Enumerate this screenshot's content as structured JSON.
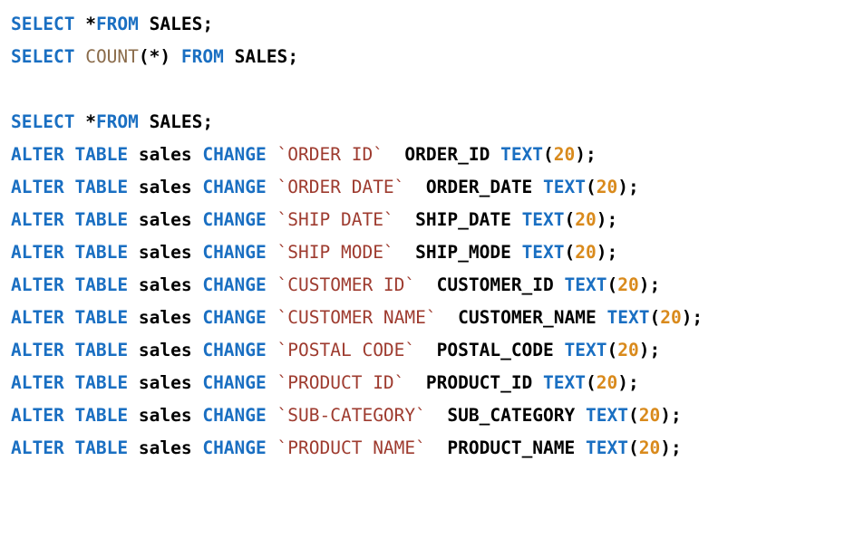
{
  "colors": {
    "keyword": "#1a6fc2",
    "function": "#8a6b4a",
    "string": "#9e3b2f",
    "number": "#d98a1c",
    "text": "#000000",
    "background": "#ffffff"
  },
  "lines": [
    {
      "tokens": [
        {
          "t": "kw",
          "v": "SELECT"
        },
        {
          "t": "ident",
          "v": " *"
        },
        {
          "t": "kw",
          "v": "FROM"
        },
        {
          "t": "ident",
          "v": " SALES"
        },
        {
          "t": "punc",
          "v": ";"
        }
      ]
    },
    {
      "tokens": [
        {
          "t": "kw",
          "v": "SELECT"
        },
        {
          "t": "ident",
          "v": " "
        },
        {
          "t": "fn",
          "v": "COUNT"
        },
        {
          "t": "punc",
          "v": "(*)"
        },
        {
          "t": "ident",
          "v": " "
        },
        {
          "t": "kw",
          "v": "FROM"
        },
        {
          "t": "ident",
          "v": " SALES"
        },
        {
          "t": "punc",
          "v": ";"
        }
      ]
    },
    {
      "tokens": []
    },
    {
      "tokens": [
        {
          "t": "kw",
          "v": "SELECT"
        },
        {
          "t": "ident",
          "v": " *"
        },
        {
          "t": "kw",
          "v": "FROM"
        },
        {
          "t": "ident",
          "v": " SALES"
        },
        {
          "t": "punc",
          "v": ";"
        }
      ]
    },
    {
      "tokens": [
        {
          "t": "kw",
          "v": "ALTER TABLE"
        },
        {
          "t": "ident",
          "v": " sales "
        },
        {
          "t": "kw",
          "v": "CHANGE"
        },
        {
          "t": "ident",
          "v": " "
        },
        {
          "t": "str",
          "v": "`ORDER ID`"
        },
        {
          "t": "ident",
          "v": "  ORDER_ID "
        },
        {
          "t": "kw",
          "v": "TEXT"
        },
        {
          "t": "punc",
          "v": "("
        },
        {
          "t": "num",
          "v": "20"
        },
        {
          "t": "punc",
          "v": ");"
        }
      ]
    },
    {
      "tokens": [
        {
          "t": "kw",
          "v": "ALTER TABLE"
        },
        {
          "t": "ident",
          "v": " sales "
        },
        {
          "t": "kw",
          "v": "CHANGE"
        },
        {
          "t": "ident",
          "v": " "
        },
        {
          "t": "str",
          "v": "`ORDER DATE`"
        },
        {
          "t": "ident",
          "v": "  ORDER_DATE "
        },
        {
          "t": "kw",
          "v": "TEXT"
        },
        {
          "t": "punc",
          "v": "("
        },
        {
          "t": "num",
          "v": "20"
        },
        {
          "t": "punc",
          "v": ");"
        }
      ]
    },
    {
      "tokens": [
        {
          "t": "kw",
          "v": "ALTER TABLE"
        },
        {
          "t": "ident",
          "v": " sales "
        },
        {
          "t": "kw",
          "v": "CHANGE"
        },
        {
          "t": "ident",
          "v": " "
        },
        {
          "t": "str",
          "v": "`SHIP DATE`"
        },
        {
          "t": "ident",
          "v": "  SHIP_DATE "
        },
        {
          "t": "kw",
          "v": "TEXT"
        },
        {
          "t": "punc",
          "v": "("
        },
        {
          "t": "num",
          "v": "20"
        },
        {
          "t": "punc",
          "v": ");"
        }
      ]
    },
    {
      "tokens": [
        {
          "t": "kw",
          "v": "ALTER TABLE"
        },
        {
          "t": "ident",
          "v": " sales "
        },
        {
          "t": "kw",
          "v": "CHANGE"
        },
        {
          "t": "ident",
          "v": " "
        },
        {
          "t": "str",
          "v": "`SHIP MODE`"
        },
        {
          "t": "ident",
          "v": "  SHIP_MODE "
        },
        {
          "t": "kw",
          "v": "TEXT"
        },
        {
          "t": "punc",
          "v": "("
        },
        {
          "t": "num",
          "v": "20"
        },
        {
          "t": "punc",
          "v": ");"
        }
      ]
    },
    {
      "tokens": [
        {
          "t": "kw",
          "v": "ALTER TABLE"
        },
        {
          "t": "ident",
          "v": " sales "
        },
        {
          "t": "kw",
          "v": "CHANGE"
        },
        {
          "t": "ident",
          "v": " "
        },
        {
          "t": "str",
          "v": "`CUSTOMER ID`"
        },
        {
          "t": "ident",
          "v": "  CUSTOMER_ID "
        },
        {
          "t": "kw",
          "v": "TEXT"
        },
        {
          "t": "punc",
          "v": "("
        },
        {
          "t": "num",
          "v": "20"
        },
        {
          "t": "punc",
          "v": ");"
        }
      ]
    },
    {
      "tokens": [
        {
          "t": "kw",
          "v": "ALTER TABLE"
        },
        {
          "t": "ident",
          "v": " sales "
        },
        {
          "t": "kw",
          "v": "CHANGE"
        },
        {
          "t": "ident",
          "v": " "
        },
        {
          "t": "str",
          "v": "`CUSTOMER NAME`"
        },
        {
          "t": "ident",
          "v": "  CUSTOMER_NAME "
        },
        {
          "t": "kw",
          "v": "TEXT"
        },
        {
          "t": "punc",
          "v": "("
        },
        {
          "t": "num",
          "v": "20"
        },
        {
          "t": "punc",
          "v": ");"
        }
      ]
    },
    {
      "tokens": [
        {
          "t": "kw",
          "v": "ALTER TABLE"
        },
        {
          "t": "ident",
          "v": " sales "
        },
        {
          "t": "kw",
          "v": "CHANGE"
        },
        {
          "t": "ident",
          "v": " "
        },
        {
          "t": "str",
          "v": "`POSTAL CODE`"
        },
        {
          "t": "ident",
          "v": "  POSTAL_CODE "
        },
        {
          "t": "kw",
          "v": "TEXT"
        },
        {
          "t": "punc",
          "v": "("
        },
        {
          "t": "num",
          "v": "20"
        },
        {
          "t": "punc",
          "v": ");"
        }
      ]
    },
    {
      "tokens": [
        {
          "t": "kw",
          "v": "ALTER TABLE"
        },
        {
          "t": "ident",
          "v": " sales "
        },
        {
          "t": "kw",
          "v": "CHANGE"
        },
        {
          "t": "ident",
          "v": " "
        },
        {
          "t": "str",
          "v": "`PRODUCT ID`"
        },
        {
          "t": "ident",
          "v": "  PRODUCT_ID "
        },
        {
          "t": "kw",
          "v": "TEXT"
        },
        {
          "t": "punc",
          "v": "("
        },
        {
          "t": "num",
          "v": "20"
        },
        {
          "t": "punc",
          "v": ");"
        }
      ]
    },
    {
      "tokens": [
        {
          "t": "kw",
          "v": "ALTER TABLE"
        },
        {
          "t": "ident",
          "v": " sales "
        },
        {
          "t": "kw",
          "v": "CHANGE"
        },
        {
          "t": "ident",
          "v": " "
        },
        {
          "t": "str",
          "v": "`SUB-CATEGORY`"
        },
        {
          "t": "ident",
          "v": "  SUB_CATEGORY "
        },
        {
          "t": "kw",
          "v": "TEXT"
        },
        {
          "t": "punc",
          "v": "("
        },
        {
          "t": "num",
          "v": "20"
        },
        {
          "t": "punc",
          "v": ");"
        }
      ]
    },
    {
      "tokens": [
        {
          "t": "kw",
          "v": "ALTER TABLE"
        },
        {
          "t": "ident",
          "v": " sales "
        },
        {
          "t": "kw",
          "v": "CHANGE"
        },
        {
          "t": "ident",
          "v": " "
        },
        {
          "t": "str",
          "v": "`PRODUCT NAME`"
        },
        {
          "t": "ident",
          "v": "  PRODUCT_NAME "
        },
        {
          "t": "kw",
          "v": "TEXT"
        },
        {
          "t": "punc",
          "v": "("
        },
        {
          "t": "num",
          "v": "20"
        },
        {
          "t": "punc",
          "v": ");"
        }
      ]
    }
  ]
}
